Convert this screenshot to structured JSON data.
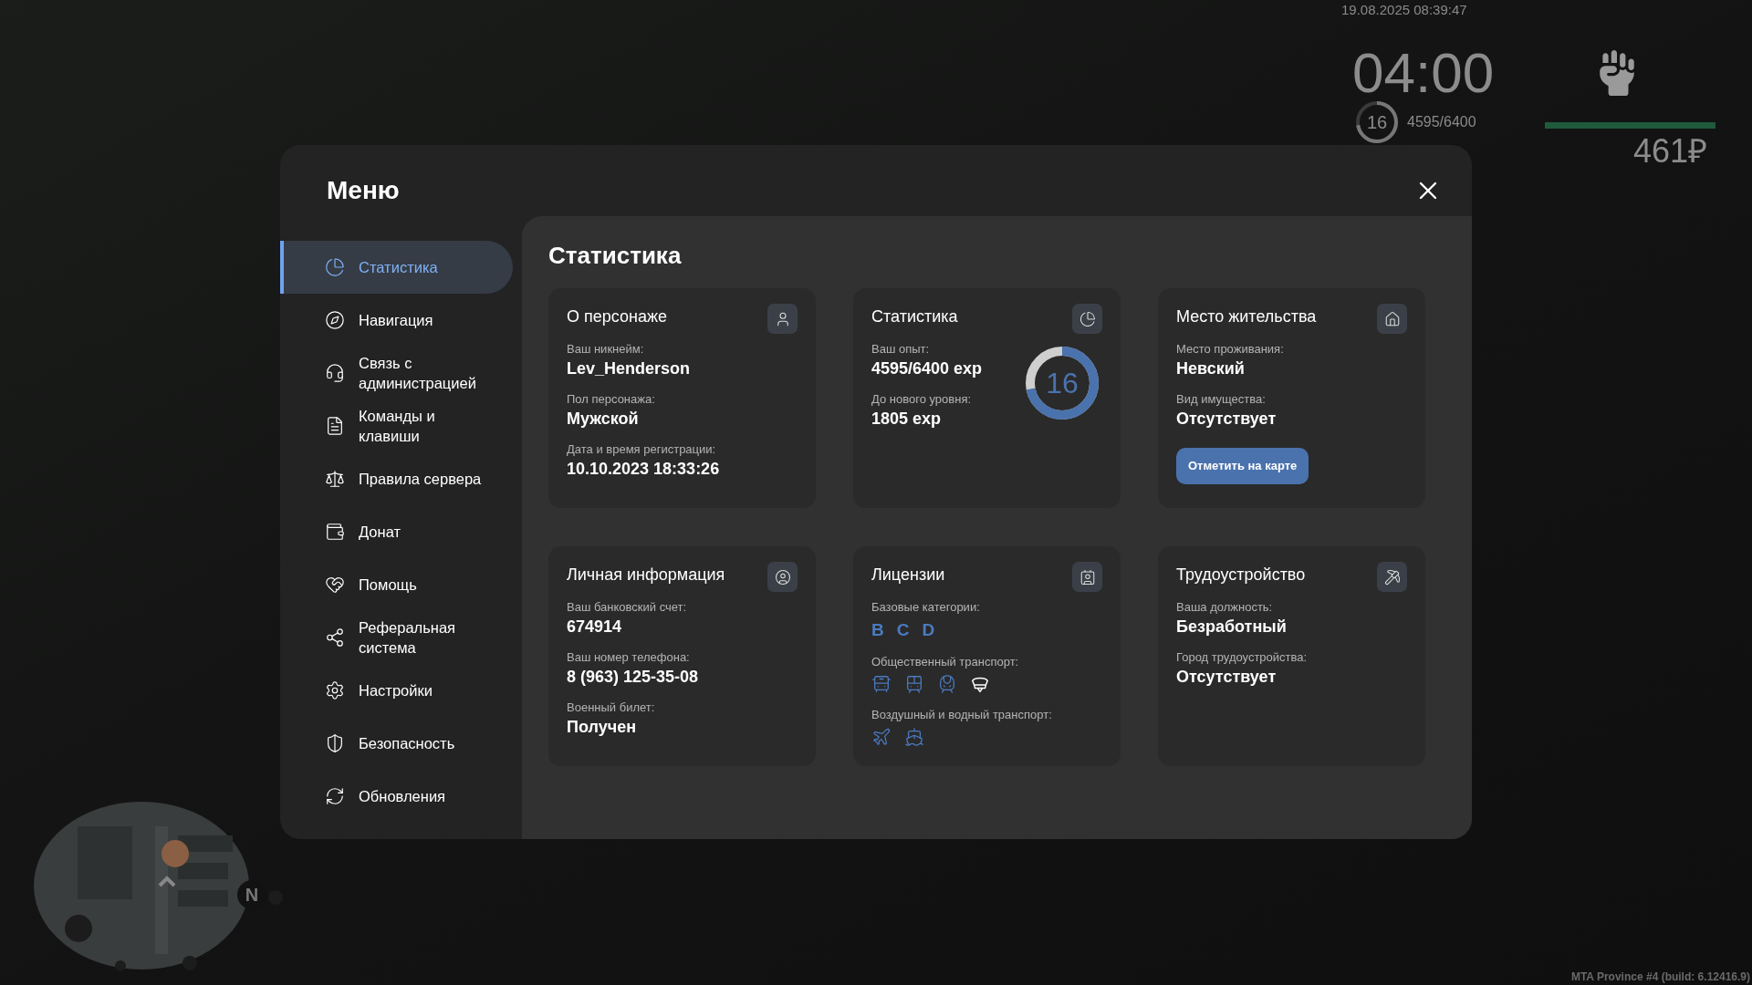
{
  "hud": {
    "datetime": "19.08.2025 08:39:47",
    "clock": "04:00",
    "level_label": "16",
    "level": 0.72,
    "exp": "4595/6400",
    "health_bar": {
      "level": 1
    },
    "money": "461₽"
  },
  "menu": {
    "title": "Меню",
    "sidebar": [
      {
        "label": "Статистика",
        "selected": true
      },
      {
        "label": "Навигация",
        "selected": false
      },
      {
        "label": "Связь с администрацией",
        "selected": false
      },
      {
        "label": "Команды и клавиши",
        "selected": false
      },
      {
        "label": "Правила сервера",
        "selected": false
      },
      {
        "label": "Донат",
        "selected": false
      },
      {
        "label": "Помощь",
        "selected": false
      },
      {
        "label": "Реферальная система",
        "selected": false
      },
      {
        "label": "Настройки",
        "selected": false
      },
      {
        "label": "Безопасность",
        "selected": false
      },
      {
        "label": "Обновления",
        "selected": false
      }
    ],
    "page_title": "Статистика",
    "cards": [
      {
        "kind": "fields",
        "title": "О персонаже",
        "fields": [
          {
            "label": "Ваш никнейм:",
            "value": "Lev_Henderson"
          },
          {
            "label": "Пол персонажа:",
            "value": "Мужской"
          },
          {
            "label": "Дата и время регистрации:",
            "value": "10.10.2023 18:33:26"
          }
        ]
      },
      {
        "kind": "progress",
        "title": "Статистика",
        "fields": [
          {
            "label": "Ваш опыт:",
            "value": "4595/6400 exp"
          },
          {
            "label": "До нового уровня:",
            "value": "1805 exp"
          }
        ],
        "ring": {
          "label": "16",
          "level": 0.72
        }
      },
      {
        "kind": "fields",
        "title": "Место жительства",
        "fields": [
          {
            "label": "Место проживания:",
            "value": "Невский"
          },
          {
            "label": "Вид имущества:",
            "value": "Отсутствует"
          }
        ],
        "button": "Отметить на карте"
      },
      {
        "kind": "fields",
        "title": "Личная информация",
        "fields": [
          {
            "label": "Ваш банковский счет:",
            "value": "674914"
          },
          {
            "label": "Ваш номер телефона:",
            "value": "8 (963) 125-35-08"
          },
          {
            "label": "Военный билет:",
            "value": "Получен"
          }
        ]
      },
      {
        "kind": "licenses",
        "title": "Лицензии",
        "sections": [
          {
            "kind": "letters",
            "label": "Базовые категории:",
            "items": [
              {
                "text": "B",
                "active": true
              },
              {
                "text": "C",
                "active": true
              },
              {
                "text": "D",
                "active": true
              }
            ]
          },
          {
            "kind": "icons",
            "label": "Общественный транспорт:",
            "items": [
              {
                "active": true
              },
              {
                "active": true
              },
              {
                "active": true
              },
              {
                "active": false
              }
            ]
          },
          {
            "kind": "icons",
            "label": "Воздушный и водный транспорт:",
            "items": [
              {
                "active": true
              },
              {
                "active": true
              }
            ]
          }
        ]
      },
      {
        "kind": "fields",
        "title": "Трудоустройство",
        "fields": [
          {
            "label": "Ваша должность:",
            "value": "Безработный"
          },
          {
            "label": "Город трудоустройства:",
            "value": "Отсутствует"
          }
        ]
      }
    ]
  },
  "minimap": {
    "north_label": "N"
  },
  "build_info": "MTA Province #4 (build: 6.12416.9)"
}
